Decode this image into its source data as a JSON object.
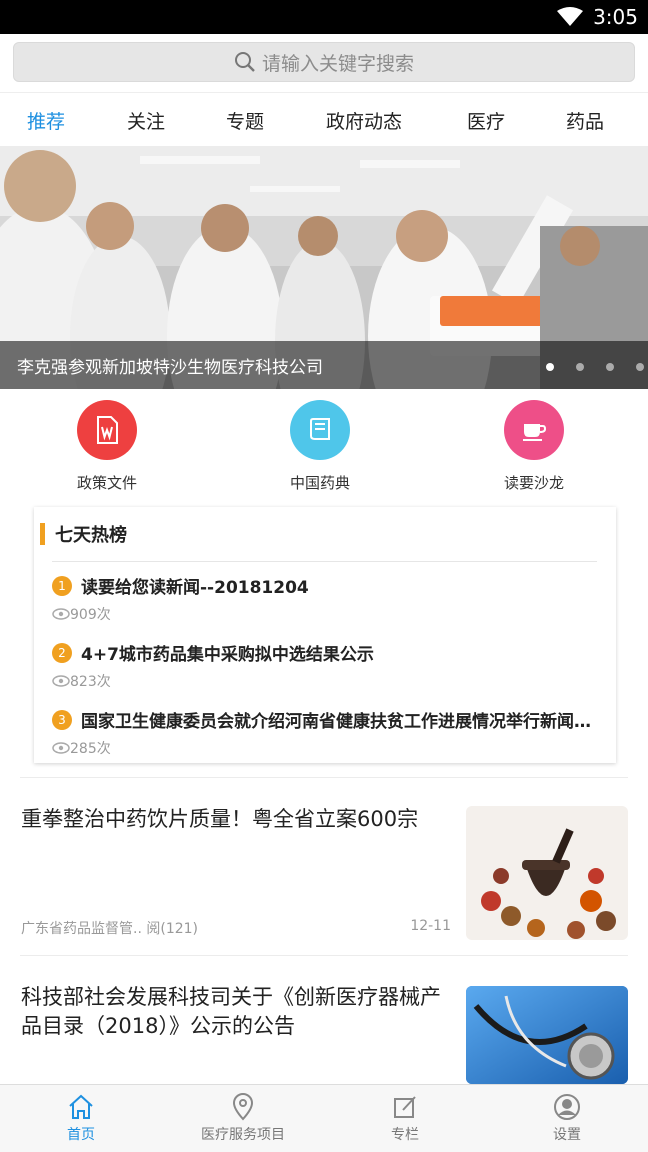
{
  "status": {
    "time": "3:05"
  },
  "search": {
    "placeholder": "请输入关键字搜索"
  },
  "tabs": [
    {
      "label": "推荐",
      "active": true
    },
    {
      "label": "关注"
    },
    {
      "label": "专题"
    },
    {
      "label": "政府动态"
    },
    {
      "label": "医疗"
    },
    {
      "label": "药品"
    }
  ],
  "banner": {
    "caption": "李克强参观新加坡特沙生物医疗科技公司",
    "dots": 4,
    "active_dot": 1
  },
  "quick_links": [
    {
      "label": "政策文件",
      "icon": "word-document-icon",
      "color": "#ee4040"
    },
    {
      "label": "中国药典",
      "icon": "book-icon",
      "color": "#4fc6ea"
    },
    {
      "label": "读要沙龙",
      "icon": "coffee-cup-icon",
      "color": "#ee4f88"
    }
  ],
  "hot_list": {
    "title": "七天热榜",
    "items": [
      {
        "rank": "1",
        "title": "读要给您读新闻--20181204",
        "views": "909次"
      },
      {
        "rank": "2",
        "title": "4+7城市药品集中采购拟中选结果公示",
        "views": "823次"
      },
      {
        "rank": "3",
        "title": "国家卫生健康委员会就介绍河南省健康扶贫工作进展情况举行新闻发布会",
        "views": "285次"
      }
    ]
  },
  "news": [
    {
      "title": "重拳整治中药饮片质量！粤全省立案600宗",
      "source": "广东省药品监督管..",
      "reads": "阅(121)",
      "date": "12-11"
    },
    {
      "title": "科技部社会发展科技司关于《创新医疗器械产品目录（2018）》公示的公告",
      "source": "",
      "reads": "",
      "date": ""
    }
  ],
  "bottom_nav": [
    {
      "label": "首页",
      "icon": "home-icon",
      "active": true
    },
    {
      "label": "医疗服务项目",
      "icon": "location-pin-icon"
    },
    {
      "label": "专栏",
      "icon": "edit-icon"
    },
    {
      "label": "设置",
      "icon": "user-icon"
    }
  ],
  "colors": {
    "accent": "#1e90e0",
    "hot_badge": "#f0a020"
  }
}
